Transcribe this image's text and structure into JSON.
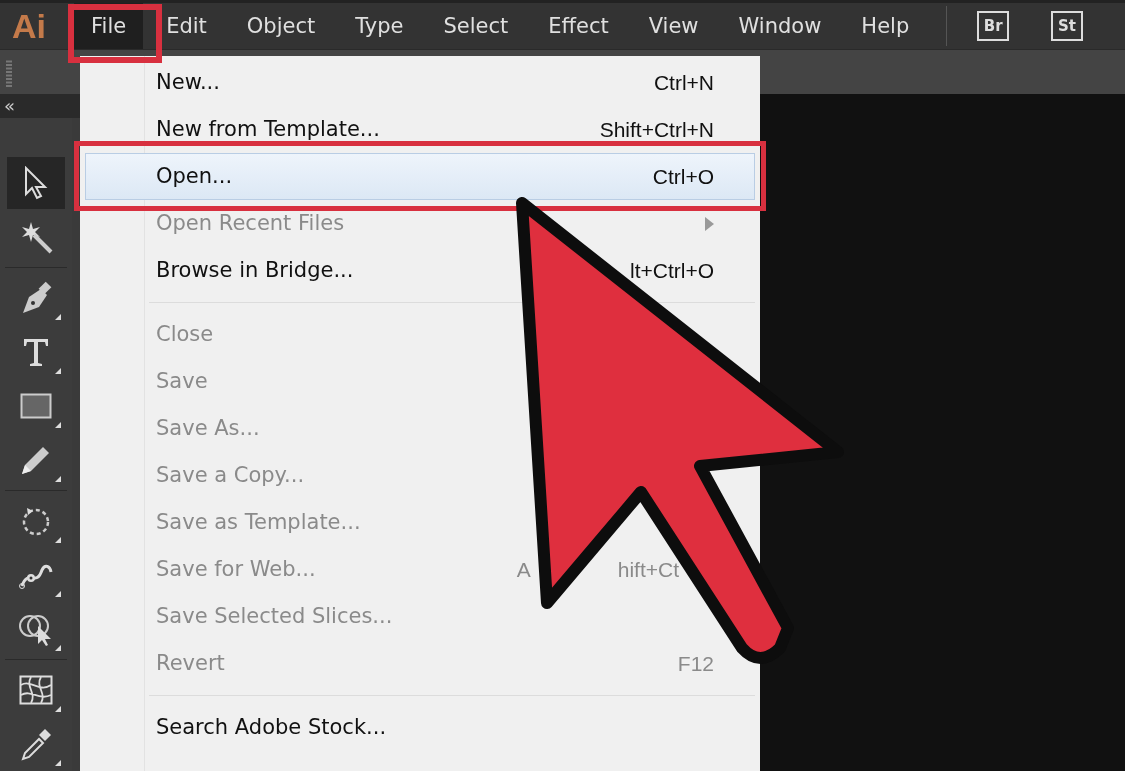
{
  "app_logo": "Ai",
  "menubar": [
    {
      "label": "File",
      "selected": true
    },
    {
      "label": "Edit",
      "selected": false
    },
    {
      "label": "Object",
      "selected": false
    },
    {
      "label": "Type",
      "selected": false
    },
    {
      "label": "Select",
      "selected": false
    },
    {
      "label": "Effect",
      "selected": false
    },
    {
      "label": "View",
      "selected": false
    },
    {
      "label": "Window",
      "selected": false
    },
    {
      "label": "Help",
      "selected": false
    }
  ],
  "app_buttons": [
    "Br",
    "St"
  ],
  "panel_collapse": "«",
  "tools": [
    {
      "kind": "selection",
      "selected": true
    },
    {
      "kind": "wand",
      "selected": false
    },
    {
      "kind": "pen",
      "selected": false
    },
    {
      "kind": "type",
      "selected": false
    },
    {
      "kind": "rectangle",
      "selected": false
    },
    {
      "kind": "pencil",
      "selected": false
    },
    {
      "kind": "rotate",
      "selected": false
    },
    {
      "kind": "warp",
      "selected": false
    },
    {
      "kind": "shape-builder",
      "selected": false
    },
    {
      "kind": "mesh",
      "selected": false
    },
    {
      "kind": "eyedropper",
      "selected": false
    }
  ],
  "file_menu": [
    {
      "kind": "item",
      "label": "New...",
      "shortcut": [
        "Ctrl+N"
      ],
      "disabled": false,
      "selected": false
    },
    {
      "kind": "item",
      "label": "New from Template...",
      "shortcut": [
        "Shift+Ctrl+N"
      ],
      "disabled": false,
      "selected": false
    },
    {
      "kind": "item",
      "label": "Open...",
      "shortcut": [
        "Ctrl+O"
      ],
      "disabled": false,
      "selected": true
    },
    {
      "kind": "submenu",
      "label": "Open Recent Files",
      "disabled": true,
      "selected": false
    },
    {
      "kind": "item",
      "label": "Browse in Bridge...",
      "shortcut": [
        "lt+Ctrl+O"
      ],
      "disabled": false,
      "selected": false
    },
    {
      "kind": "separator"
    },
    {
      "kind": "item",
      "label": "Close",
      "disabled": true,
      "selected": false
    },
    {
      "kind": "item",
      "label": "Save",
      "disabled": true,
      "selected": false
    },
    {
      "kind": "item",
      "label": "Save As...",
      "disabled": true,
      "selected": false
    },
    {
      "kind": "item",
      "label": "Save a Copy...",
      "disabled": true,
      "selected": false
    },
    {
      "kind": "item",
      "label": "Save as Template...",
      "disabled": true,
      "selected": false
    },
    {
      "kind": "item",
      "label": "Save for Web...",
      "shortcut": [
        "A",
        "hift+Ct"
      ],
      "disabled": true,
      "selected": false
    },
    {
      "kind": "item",
      "label": "Save Selected Slices...",
      "disabled": true,
      "selected": false
    },
    {
      "kind": "item",
      "label": "Revert",
      "shortcut": [
        "F12"
      ],
      "disabled": true,
      "selected": false
    },
    {
      "kind": "separator"
    },
    {
      "kind": "item",
      "label": "Search Adobe Stock...",
      "disabled": false,
      "selected": false
    }
  ]
}
